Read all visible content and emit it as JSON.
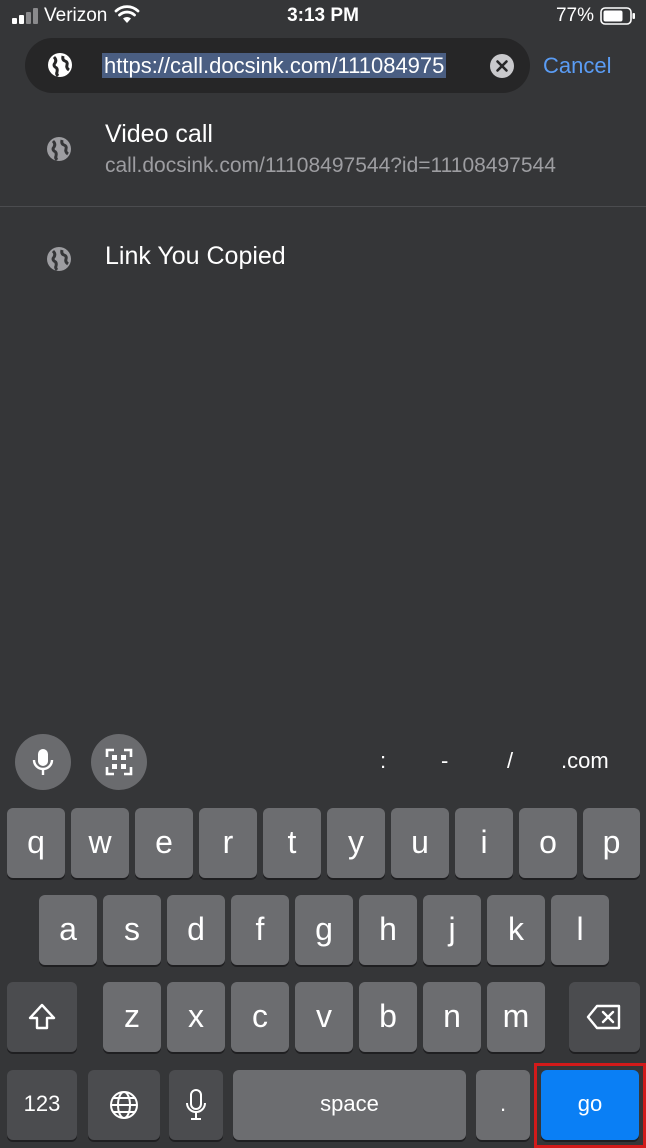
{
  "status_bar": {
    "carrier": "Verizon",
    "time": "3:13 PM",
    "battery": "77%"
  },
  "url_bar": {
    "value": "https://call.docsink.com/111084975",
    "cancel_label": "Cancel"
  },
  "suggestions": [
    {
      "title": "Video call",
      "subtitle": "call.docsink.com/11108497544?id=11108497544"
    },
    {
      "title": "Link You Copied"
    }
  ],
  "accessory": {
    "keys": [
      ":",
      "-",
      "/",
      ".com"
    ]
  },
  "keyboard": {
    "row1": [
      "q",
      "w",
      "e",
      "r",
      "t",
      "y",
      "u",
      "i",
      "o",
      "p"
    ],
    "row2": [
      "a",
      "s",
      "d",
      "f",
      "g",
      "h",
      "j",
      "k",
      "l"
    ],
    "row3": [
      "z",
      "x",
      "c",
      "v",
      "b",
      "n",
      "m"
    ],
    "numbers_label": "123",
    "space_label": "space",
    "period_label": ".",
    "go_label": "go"
  },
  "colors": {
    "background": "#353638",
    "accent": "#5a9cf4",
    "go_key": "#0a7ff5",
    "highlight": "#d21a1a"
  },
  "icons": [
    "globe-icon",
    "clear-icon",
    "mic-icon",
    "qr-scan-icon",
    "shift-icon",
    "backspace-icon",
    "wifi-icon",
    "battery-icon",
    "cellular-signal-icon"
  ]
}
